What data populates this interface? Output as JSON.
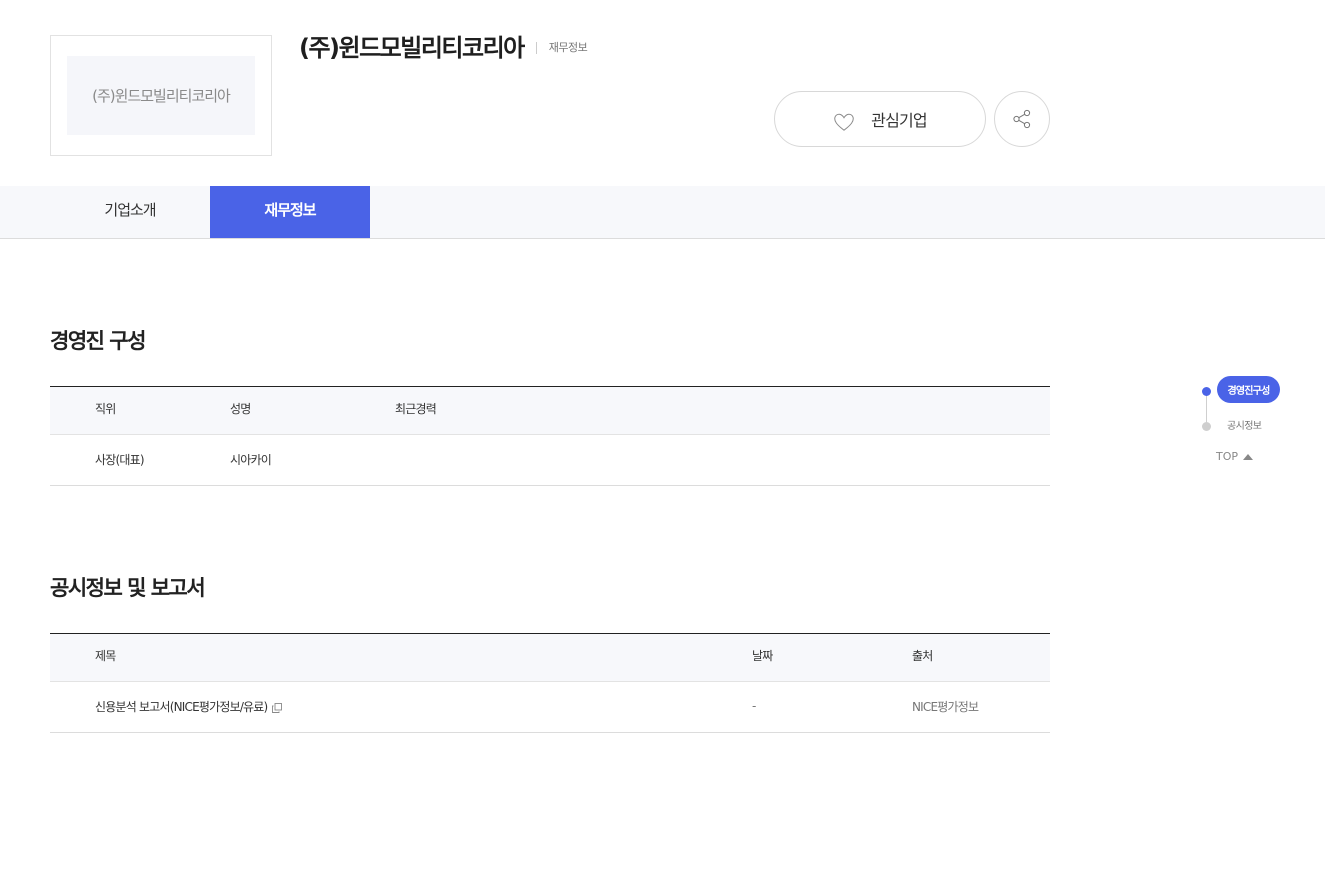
{
  "company": {
    "logo_text": "(주)윈드모빌리티코리아",
    "name": "(주)윈드모빌리티코리아",
    "current_section": "재무정보"
  },
  "actions": {
    "favorite_label": "관심기업",
    "heart_icon": "heart-outline-icon",
    "share_icon": "share-icon"
  },
  "tabs": [
    {
      "label": "기업소개",
      "active": false
    },
    {
      "label": "재무정보",
      "active": true
    }
  ],
  "executives": {
    "title": "경영진 구성",
    "headers": [
      "직위",
      "성명",
      "최근경력"
    ],
    "rows": [
      {
        "position": "사장(대표)",
        "name": "시아카이",
        "career": ""
      }
    ]
  },
  "disclosures": {
    "title": "공시정보 및 보고서",
    "headers": [
      "제목",
      "날짜",
      "출처"
    ],
    "rows": [
      {
        "title": "신용분석 보고서(NICE평가정보/유료)",
        "date": "-",
        "source": "NICE평가정보",
        "link_icon": "external-link-icon"
      }
    ]
  },
  "side_nav": {
    "items": [
      {
        "label": "경영진구성",
        "active": true
      },
      {
        "label": "공시정보",
        "active": false
      }
    ],
    "top_label": "TOP"
  },
  "colors": {
    "accent": "#4a63e7",
    "border": "#dcdcdc",
    "header_bg": "#f7f8fb"
  }
}
